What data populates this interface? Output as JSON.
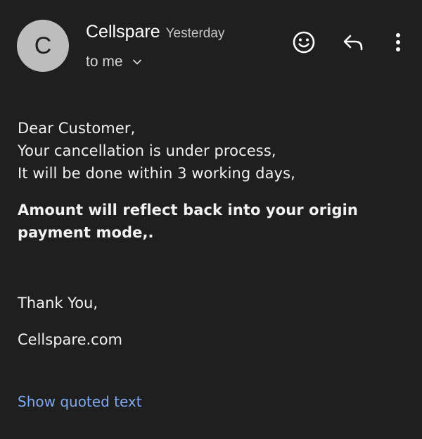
{
  "sender": {
    "avatar_letter": "C",
    "name": "Cellspare",
    "time": "Yesterday",
    "recipient": "to me"
  },
  "icons": {
    "emoji": "emoji-react-icon",
    "reply": "reply-icon",
    "more": "more-vertical-icon",
    "expand": "chevron-down-icon"
  },
  "message": {
    "lines": [
      "Dear Customer,",
      "Your cancellation is under process,",
      "It will be done within 3 working days,"
    ],
    "bold_line_1": "Amount will reflect back into your origin",
    "bold_line_2": "payment mode,.",
    "thanks": "Thank You,",
    "signature": "Cellspare.com"
  },
  "show_quoted_text": "Show quoted text",
  "colors": {
    "background": "#1f1f1f",
    "avatar": "#bdbdbd",
    "link": "#7fa9f0"
  }
}
